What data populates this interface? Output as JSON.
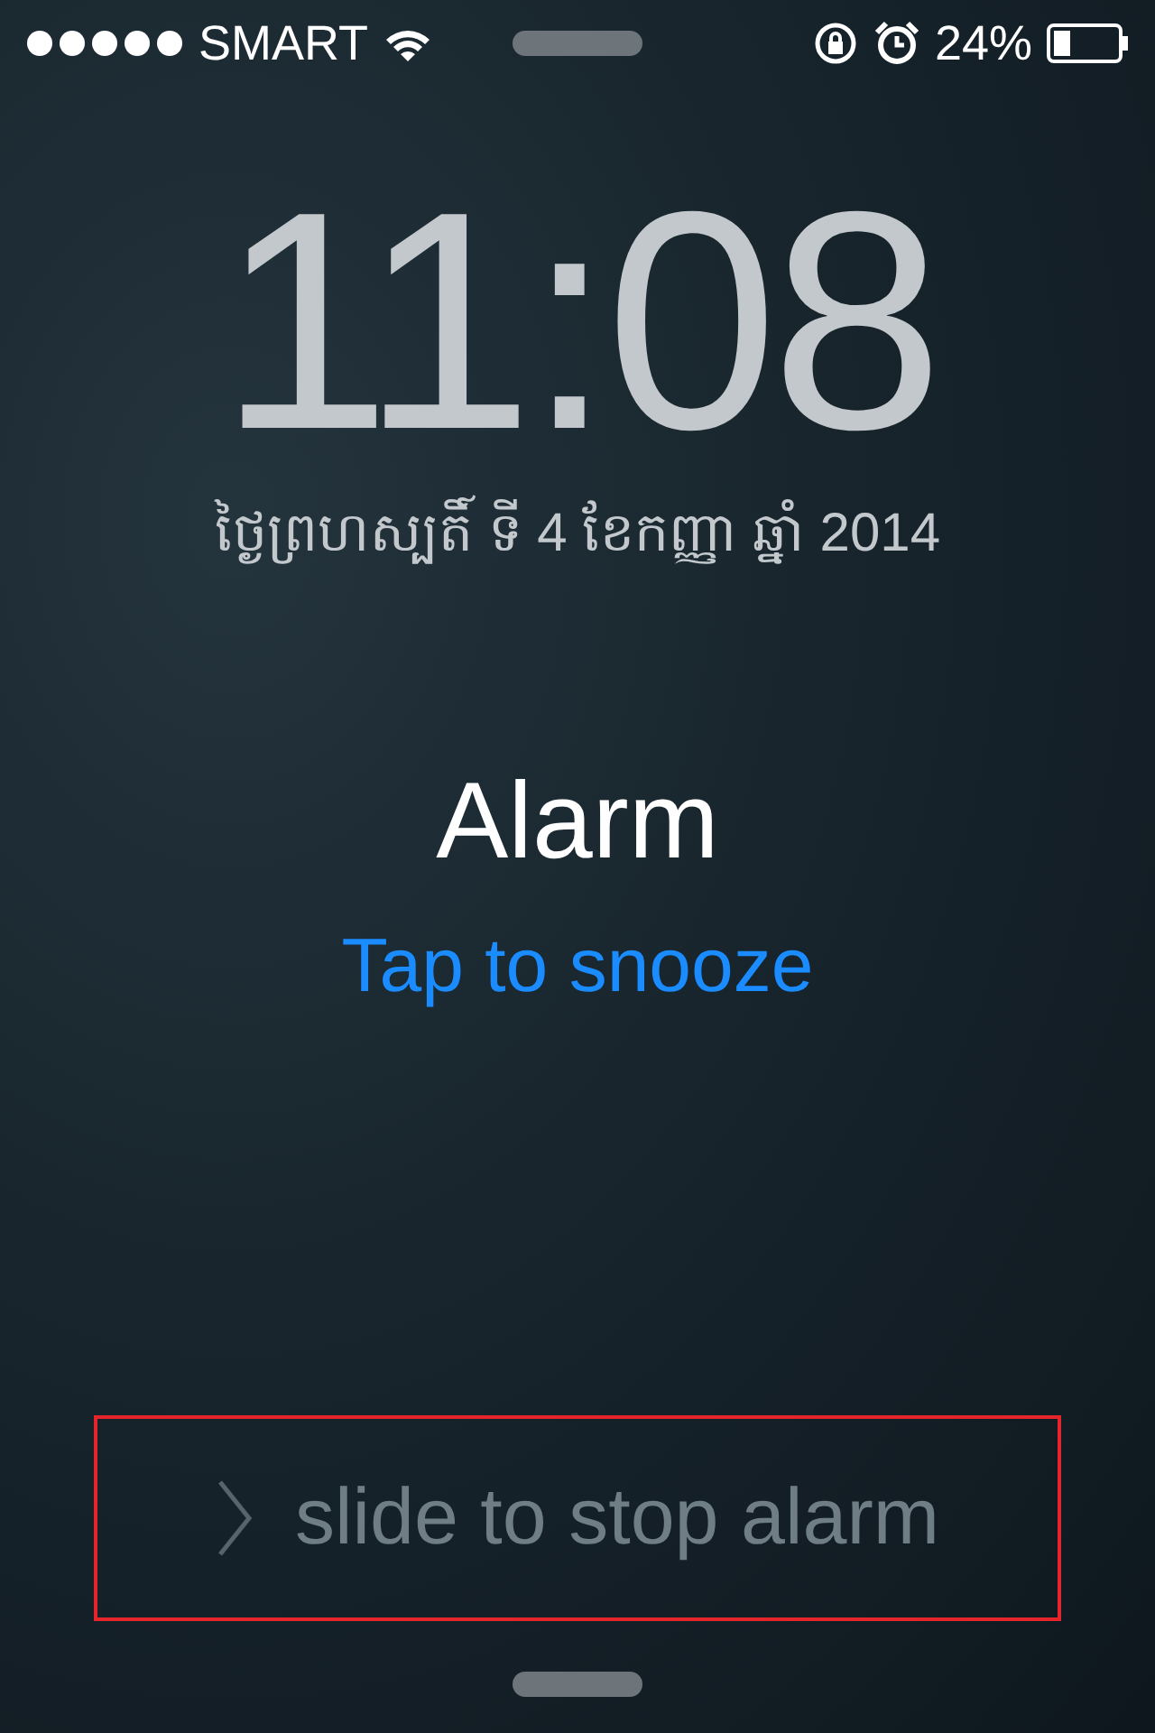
{
  "status_bar": {
    "carrier": "SMART",
    "battery": "24%"
  },
  "clock": {
    "time": "11:08",
    "date": "ថ្ងៃព្រហស្បតិ៍ ទី 4 ខែកញ្ញា ឆ្នាំ 2014"
  },
  "alarm": {
    "title": "Alarm",
    "snooze": "Tap to snooze"
  },
  "slider": {
    "label": "slide to stop alarm",
    "highlighted": true
  }
}
